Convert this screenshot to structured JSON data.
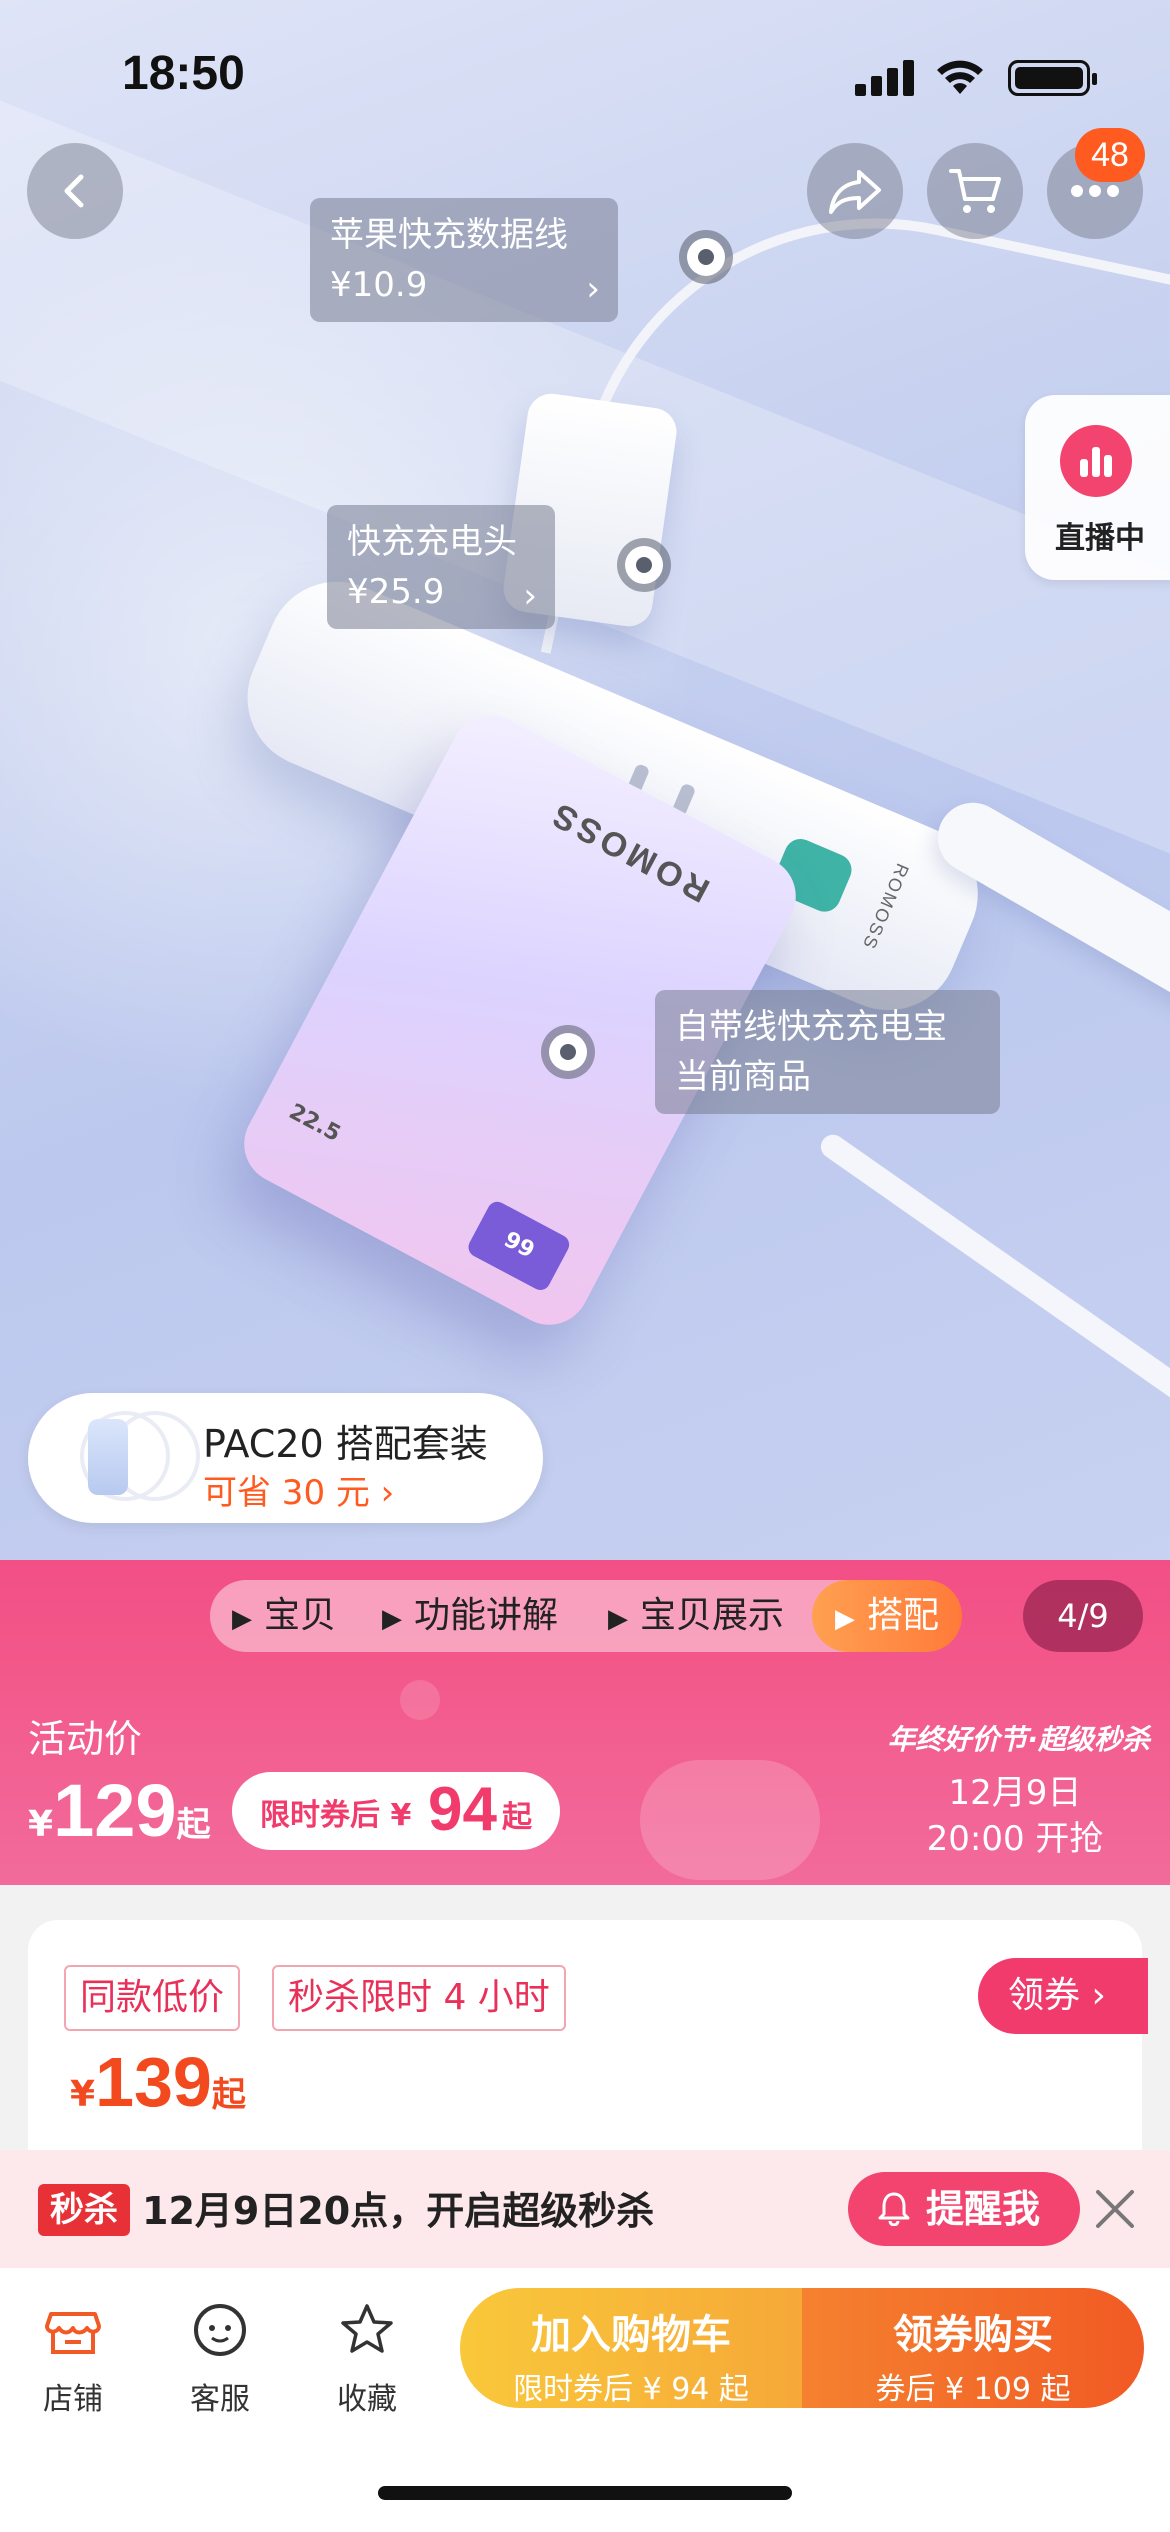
{
  "status_bar": {
    "time": "18:50"
  },
  "nav": {
    "cart_badge": "48"
  },
  "live": {
    "label": "直播中"
  },
  "hotspots": [
    {
      "name": "苹果快充数据线",
      "price": "¥10.9"
    },
    {
      "name": "快充充电头",
      "price": "¥25.9"
    },
    {
      "name": "自带线快充充电宝",
      "price": "当前商品"
    }
  ],
  "product_marks": {
    "strip_brand": "ROMOSS",
    "bank_brand": "ROMOSS",
    "bank_power": "22.5",
    "bank_screen": "99"
  },
  "combo": {
    "title": "PAC20 搭配套装",
    "save": "可省 30 元 ›"
  },
  "media_tabs": [
    {
      "label": "宝贝"
    },
    {
      "label": "功能讲解"
    },
    {
      "label": "宝贝展示"
    },
    {
      "label": "搭配"
    }
  ],
  "pager": "4/9",
  "promo": {
    "label": "活动价",
    "currency": "¥",
    "price": "129",
    "suffix": "起",
    "coupon_text": "限时券后 ¥",
    "coupon_price": "94",
    "coupon_suffix": "起",
    "event_title": "年终好价节·超级秒杀",
    "event_date": "12月9日",
    "event_time": "20:00 开抢"
  },
  "card": {
    "chip1": "同款低价",
    "chip2": "秒杀限时 4 小时",
    "coupon_btn": "领券 ›",
    "currency": "¥",
    "price": "139",
    "suffix": "起"
  },
  "flash": {
    "tag": "秒杀",
    "message": "12月9日20点，开启超级秒杀",
    "remind": "提醒我"
  },
  "bottom": {
    "shop": "店铺",
    "service": "客服",
    "favorite": "收藏",
    "cart_main": "加入购物车",
    "cart_sub": "限时券后 ¥ 94 起",
    "buy_main": "领券购买",
    "buy_sub": "券后 ¥ 109 起"
  },
  "colors": {
    "accent": "#f24f86",
    "orange": "#f15a24",
    "yellow": "#f9c83a"
  }
}
